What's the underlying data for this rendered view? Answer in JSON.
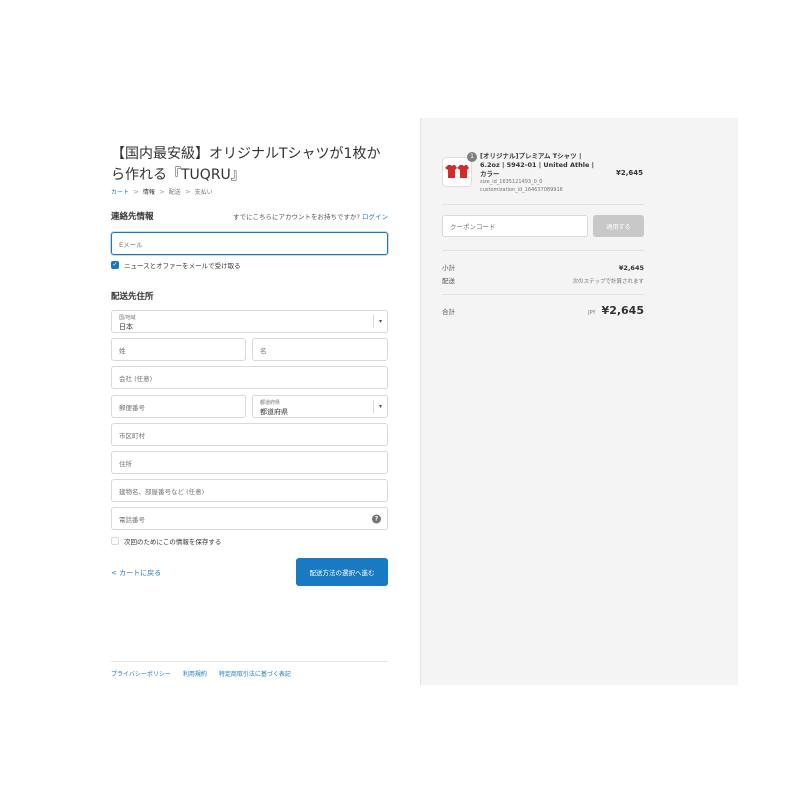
{
  "header": {
    "shop_title": "【国内最安級】オリジナルTシャツが1枚から作れる『TUQRU』",
    "breadcrumb": [
      "カート",
      "情報",
      "配送",
      "支払い"
    ],
    "breadcrumb_sep": ">"
  },
  "contact": {
    "section_title": "連絡先情報",
    "has_account_text": "すでにこちらにアカウントをお持ちですか?",
    "login_label": "ログイン",
    "email_placeholder": "Eメール",
    "newsletter_label": "ニュースとオファーをメールで受け取る",
    "newsletter_checked": true
  },
  "shipping": {
    "section_title": "配送先住所",
    "country_label": "国/地域",
    "country_value": "日本",
    "last_name_placeholder": "姓",
    "first_name_placeholder": "名",
    "company_placeholder": "会社 (任意)",
    "postal_placeholder": "郵便番号",
    "prefecture_label": "都道府県",
    "prefecture_value": "都道府県",
    "city_placeholder": "市区町村",
    "address_placeholder": "住所",
    "apartment_placeholder": "建物名、部屋番号など (任意)",
    "phone_placeholder": "電話番号",
    "save_info_label": "次回のためにこの情報を保存する",
    "save_info_checked": false
  },
  "actions": {
    "back_label": "< カートに戻る",
    "continue_label": "配送方法の選択へ進む"
  },
  "footer": {
    "links": [
      "プライバシーポリシー",
      "利用規約",
      "特定商取引法に基づく表記"
    ]
  },
  "order": {
    "item": {
      "quantity": "1",
      "name": "[オリジナル]プレミアム Tシャツ | 6.2oz | 5942-01 | United Athle | カラー",
      "size_id": "size_id_1635121493_0_0",
      "customization_id": "customization_id_164637089916",
      "price": "¥2,645"
    },
    "coupon_placeholder": "クーポンコード",
    "apply_label": "適用する",
    "subtotal_label": "小計",
    "subtotal_value": "¥2,645",
    "shipping_label": "配送",
    "shipping_value": "次のステップで計算されます",
    "total_label": "合計",
    "total_currency": "JPY",
    "total_value": "¥2,645"
  },
  "colors": {
    "accent": "#1979c3",
    "panel_bg": "#f4f4f4",
    "product_red": "#d42a2a"
  }
}
